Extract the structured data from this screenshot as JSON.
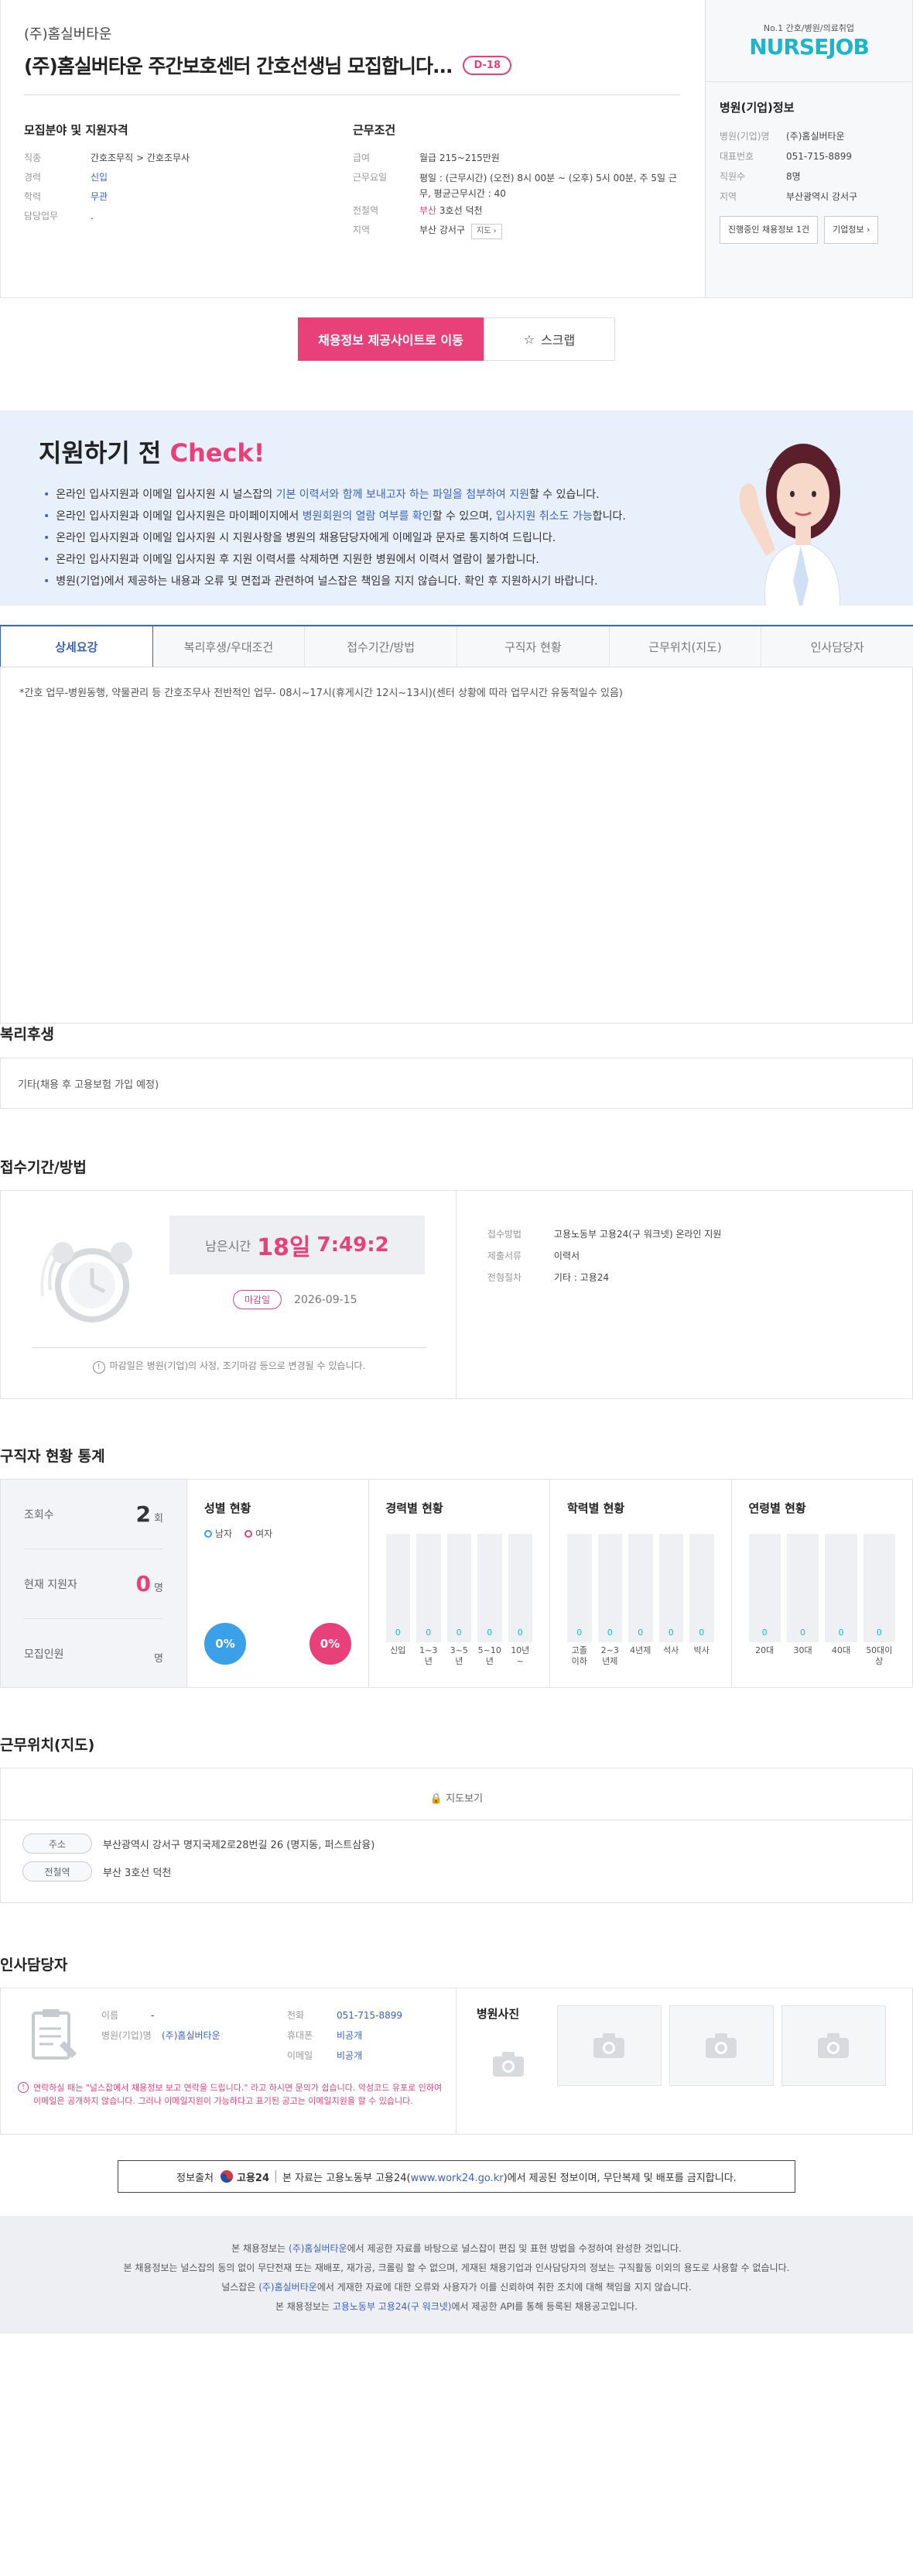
{
  "job": {
    "company": "(주)홈실버타운",
    "title": "(주)홈실버타운 주간보호센터 간호선생님 모집합니다...",
    "dday": "D-18"
  },
  "recruit": {
    "heading": "모집분야 및 지원자격",
    "rows": [
      {
        "k": "직종",
        "v": "간호조무직 > 간호조무사"
      },
      {
        "k": "경력",
        "v": "신입"
      },
      {
        "k": "학력",
        "v": "무관"
      },
      {
        "k": "담당업무",
        "v": "."
      }
    ]
  },
  "conditions": {
    "heading": "근무조건",
    "salary_k": "급여",
    "salary_v": "월급 215~215만원",
    "days_k": "근무요일",
    "days_v": "평일 : (근무시간) (오전) 8시 00분 ~ (오후) 5시 00분, 주 5일 근무, 평균근무시간 : 40",
    "subway_k": "전철역",
    "subway_line": "부산",
    "subway_v": "3호선 덕천",
    "area_k": "지역",
    "area_v": "부산 강서구",
    "map_btn": "지도"
  },
  "side": {
    "logo_sub": "No.1 간호/병원/의료취업",
    "logo_main": "NURSEJOB",
    "title": "병원(기업)정보",
    "rows": [
      {
        "k": "병원(기업)명",
        "v": "(주)홈실버타운"
      },
      {
        "k": "대표번호",
        "v": "051-715-8899"
      },
      {
        "k": "직원수",
        "v": "8명"
      },
      {
        "k": "지역",
        "v": "부산광역시 강서구"
      }
    ],
    "btn_jobs": "진행중인 채용정보 1건",
    "btn_info": "기업정보"
  },
  "apply": {
    "apply_label": "채용정보 제공사이트로 이동",
    "scrap_label": "스크랩"
  },
  "check": {
    "title": "지원하기 전",
    "title_hl": "Check!",
    "items": [
      {
        "a": "온라인 입사지원과 이메일 입사지원 시 널스잡의 ",
        "b": "기본 이력서와 함께 보내고자 하는 파일을 첨부하여 지원",
        "c": "할 수 있습니다.",
        "d": "",
        "e": ""
      },
      {
        "a": "온라인 입사지원과 이메일 입사지원은 마이페이지에서 ",
        "b": "병원회원의 열람 여부를 확인",
        "c": "할 수 있으며, ",
        "d": "입사지원 취소도 가능",
        "e": "합니다."
      },
      {
        "a": "온라인 입사지원과 이메일 입사지원 시 지원사항을 병원의 채용담당자에게 이메일과 문자로 통지하여 드립니다.",
        "b": "",
        "c": "",
        "d": "",
        "e": ""
      },
      {
        "a": "온라인 입사지원과 이메일 입사지원 후 지원 이력서를 삭제하면 지원한 병원에서 이력서 열람이 불가합니다.",
        "b": "",
        "c": "",
        "d": "",
        "e": ""
      },
      {
        "a": "병원(기업)에서 제공하는 내용과 오류 및 면접과 관련하여 널스잡은 책임을 지지 않습니다. 확인 후 지원하시기 바랍니다.",
        "b": "",
        "c": "",
        "d": "",
        "e": ""
      }
    ]
  },
  "tabs": [
    "상세요강",
    "복리후생/우대조건",
    "접수기간/방법",
    "구직자 현황",
    "근무위치(지도)",
    "인사담당자"
  ],
  "detail": "*간호 업무-병원동행, 약물관리 등 간호조무사 전반적인 업무- 08시~17시(휴게시간 12시~13시)(센터 상황에 따라 업무시간 유동적일수 있음)",
  "welfare": {
    "title": "복리후생",
    "text": "기타(채용 후 고용보험 가입 예정)"
  },
  "receipt": {
    "title": "접수기간/방법",
    "remain_label": "남은시간",
    "remain_days": "18일",
    "remain_time": "7:49:2",
    "deadline_badge": "마감일",
    "deadline_date": "2026-09-15",
    "notice": "마감일은 병원(기업)의 사정, 조기마감 등으로 변경될 수 있습니다.",
    "rows": [
      {
        "k": "접수방법",
        "v": "고용노동부 고용24(구 워크넷) 온라인 지원"
      },
      {
        "k": "제출서류",
        "v": "이력서"
      },
      {
        "k": "전형절차",
        "v": "기타 : 고용24"
      }
    ]
  },
  "stats": {
    "title": "구직자 현황 통계",
    "left": [
      {
        "k": "조회수",
        "v": "2",
        "unit": "회"
      },
      {
        "k": "현재 지원자",
        "v": "0",
        "unit": "명"
      },
      {
        "k": "모집인원",
        "v": "",
        "unit": "명"
      }
    ],
    "gender": {
      "title": "성별 현황",
      "male": "남자",
      "female": "여자",
      "male_pct": "0%",
      "female_pct": "0%"
    },
    "career": {
      "title": "경력별 현황",
      "labels": [
        "신입",
        "1~3년",
        "3~5년",
        "5~10년",
        "10년~"
      ],
      "values": [
        0,
        0,
        0,
        0,
        0
      ]
    },
    "edu": {
      "title": "학력별 현황",
      "labels": [
        "고졸 이하",
        "2~3년제",
        "4년제",
        "석사",
        "박사"
      ],
      "values": [
        0,
        0,
        0,
        0,
        0
      ]
    },
    "age": {
      "title": "연령별 현황",
      "labels": [
        "20대",
        "30대",
        "40대",
        "50대이상"
      ],
      "values": [
        0,
        0,
        0,
        0
      ]
    }
  },
  "location": {
    "title": "근무위치(지도)",
    "map_view": "지도보기",
    "addr_k": "주소",
    "addr_v": "부산광역시 강서구 명지국제2로28번길 26 (명지동, 퍼스트삼융)",
    "subway_k": "전철역",
    "subway_v": "부산 3호선 덕천"
  },
  "manager": {
    "title": "인사담당자",
    "name_k": "이름",
    "name_v": "-",
    "hosp_k": "병원(기업)명",
    "hosp_v": "(주)홈실버타운",
    "tel_k": "전화",
    "tel_v": "051-715-8899",
    "mobile_k": "휴대폰",
    "mobile_v": "비공개",
    "email_k": "이메일",
    "email_v": "비공개",
    "notice": "연락하실 때는 \"널스잡에서 채용정보 보고 연락을 드립니다.\" 라고 하시면 문의가 쉽습니다. 악성코드 유포로 인하여 이메일은 공개하지 않습니다. 그러나 이메일지원이 가능하다고 표기된 공고는 이메일지원을 할 수 있습니다.",
    "photos_title": "병원사진"
  },
  "source": {
    "label": "정보출처",
    "org": "고용24",
    "text_a": "본 자료는 고용노동부 고용24(",
    "url": "www.work24.go.kr",
    "text_b": ")에서 제공된 정보이며, 무단복제 및 배포를 금지합니다."
  },
  "footer": {
    "l1a": "본 채용정보는 ",
    "l1b": "(주)홈실버타운",
    "l1c": "에서 제공한 자료를 바탕으로 널스잡이 편집 및 표현 방법을 수정하여 완성한 것입니다.",
    "l2": "본 채용정보는 널스잡의 동의 없이 무단전재 또는 재배포, 재가공, 크롤링 할 수 없으며, 게재된 채용기업과 인사담당자의 정보는 구직활동 이외의 용도로 사용할 수 없습니다.",
    "l3a": "널스잡은 ",
    "l3b": "(주)홈실버타운",
    "l3c": "에서 게재한 자료에 대한 오류와 사용자가 이를 신뢰하여 취한 조치에 대해 책임을 지지 않습니다.",
    "l4a": "본 채용정보는 ",
    "l4b": "고용노동부 고용24(구 워크넷)",
    "l4c": "에서 제공한 API를 통해 등록된 채용공고입니다."
  },
  "colors": {
    "accent": "#e8417a",
    "blue": "#3a63c6",
    "teal": "#1fb4c7"
  }
}
